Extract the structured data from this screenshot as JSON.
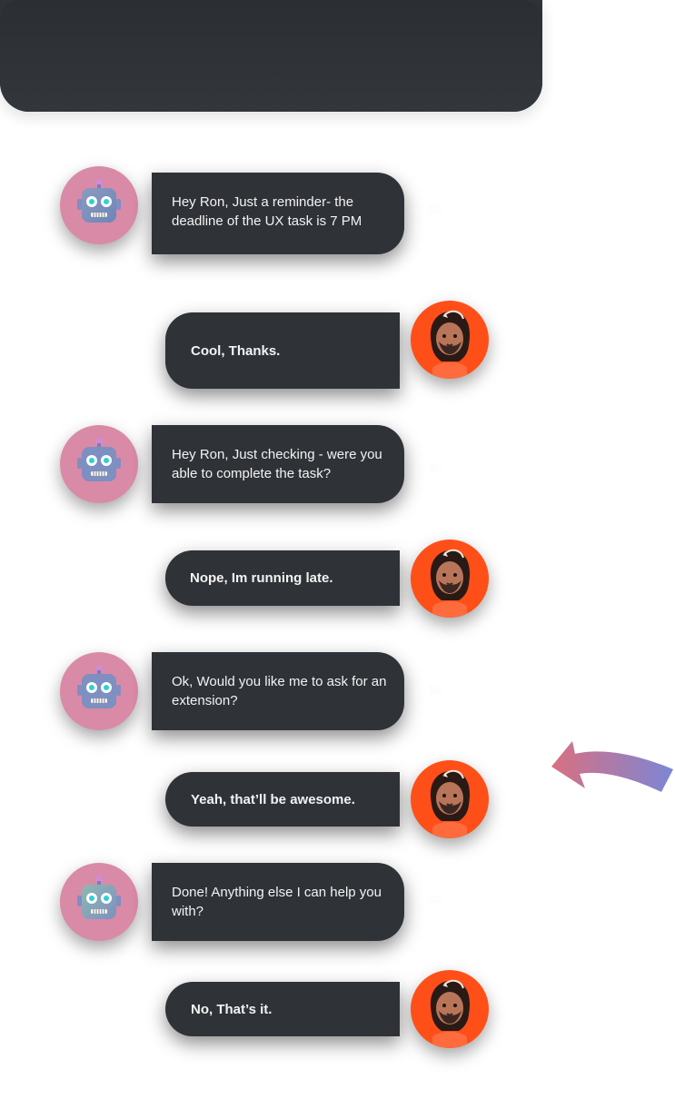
{
  "header": {
    "title": ""
  },
  "messages": [
    {
      "sender": "bot",
      "text": "Hey Ron, Just a reminder- the deadline of the UX task is 7 PM",
      "time": "11:"
    },
    {
      "sender": "user",
      "text": "Cool, Thanks."
    },
    {
      "sender": "bot",
      "text": "Hey Ron, Just checking - were you able to complete the task?",
      "time": "11:"
    },
    {
      "sender": "user",
      "text": "Nope, Im running late."
    },
    {
      "sender": "bot",
      "text": "Ok, Would you like me to ask for an extension?",
      "time": "11:"
    },
    {
      "sender": "user",
      "text": "Yeah, that’ll be awesome."
    },
    {
      "sender": "bot",
      "text": "Done! Anything else I can help you with?",
      "time": "11:"
    },
    {
      "sender": "user",
      "text": "No, That’s it."
    }
  ],
  "avatars": {
    "bot": {
      "icon": "robot-icon",
      "bg_color": "#d98aa6"
    },
    "user": {
      "icon": "person-avatar-icon",
      "bg_color": "#ff4f19"
    }
  },
  "colors": {
    "bubble_bg": "#2f3237",
    "text": "#f3f3f3",
    "arrow_start": "#d97080",
    "arrow_end": "#7c86d6"
  },
  "decor": {
    "arrow_icon": "curved-arrow-icon"
  }
}
